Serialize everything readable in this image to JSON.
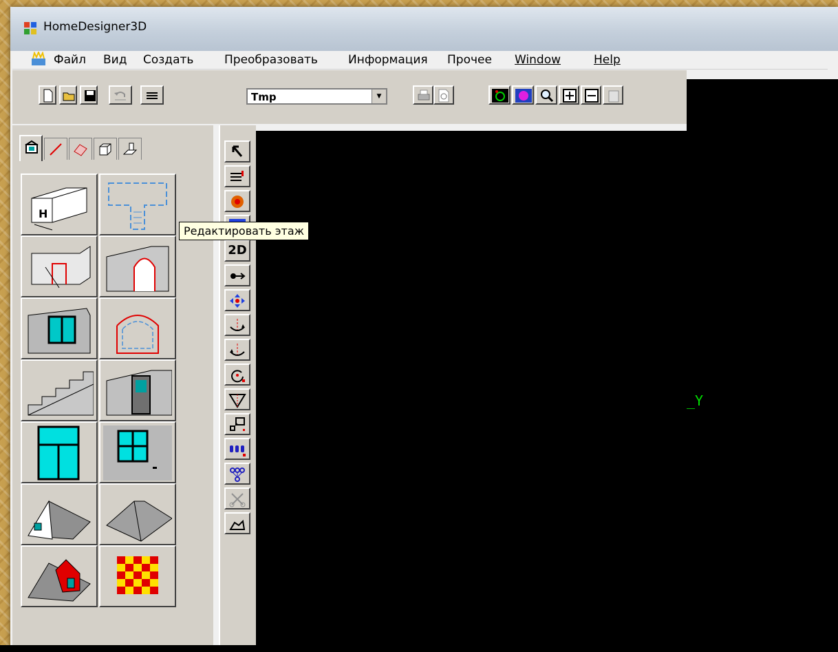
{
  "window": {
    "title": "HomeDesigner3D"
  },
  "menu": {
    "items": [
      "Файл",
      "Вид",
      "Создать",
      "Преобразовать",
      "Информация",
      "Прочее",
      "Window",
      "Help"
    ]
  },
  "toolbar": {
    "floor_select_value": "Tmp"
  },
  "tooltip": {
    "text": "Редактировать этаж"
  },
  "v_toolbar": {
    "mode_2d_label": "2D"
  },
  "canvas": {
    "axis_label": "_Y"
  },
  "colors": {
    "canvas_bg": "#000000",
    "axis": "#00e000",
    "tooltip_bg": "#ffffe1"
  }
}
